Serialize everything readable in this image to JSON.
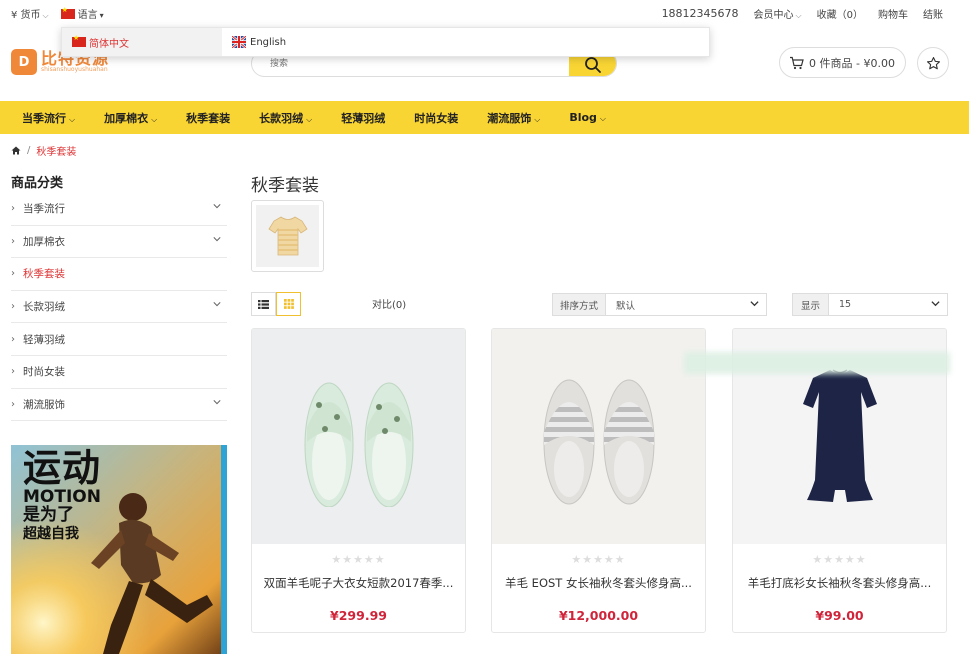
{
  "topbar": {
    "currency_label": "¥ 货币",
    "language_label": "语言",
    "phone": "18812345678",
    "account_label": "会员中心",
    "wishlist_label": "收藏（0）",
    "cart_label": "购物车",
    "checkout_label": "结账"
  },
  "language_dropdown": {
    "options": [
      {
        "label": "简体中文",
        "selected": true
      },
      {
        "label": "English",
        "selected": false
      }
    ]
  },
  "logo": {
    "text_cn": "比特资源",
    "text_en": "shisanshuoyushuahan",
    "mark": "D"
  },
  "search": {
    "placeholder": "搜索"
  },
  "cart": {
    "summary": "0 件商品 - ¥0.00"
  },
  "nav": {
    "items": [
      {
        "label": "当季流行",
        "has_dropdown": true
      },
      {
        "label": "加厚棉衣",
        "has_dropdown": true
      },
      {
        "label": "秋季套装",
        "has_dropdown": false
      },
      {
        "label": "长款羽绒",
        "has_dropdown": true
      },
      {
        "label": "轻薄羽绒",
        "has_dropdown": false
      },
      {
        "label": "时尚女装",
        "has_dropdown": false
      },
      {
        "label": "潮流服饰",
        "has_dropdown": true
      },
      {
        "label": "Blog",
        "has_dropdown": true
      }
    ]
  },
  "breadcrumb": {
    "current": "秋季套装"
  },
  "sidebar": {
    "title": "商品分类",
    "items": [
      {
        "label": "当季流行",
        "expandable": true,
        "active": false
      },
      {
        "label": "加厚棉衣",
        "expandable": true,
        "active": false
      },
      {
        "label": "秋季套装",
        "expandable": false,
        "active": true
      },
      {
        "label": "长款羽绒",
        "expandable": true,
        "active": false
      },
      {
        "label": "轻薄羽绒",
        "expandable": false,
        "active": false
      },
      {
        "label": "时尚女装",
        "expandable": false,
        "active": false
      },
      {
        "label": "潮流服饰",
        "expandable": true,
        "active": false
      }
    ],
    "banner": {
      "line1": "运动",
      "line2": "MOTION",
      "line3": "是为了",
      "line4": "超越自我"
    }
  },
  "main": {
    "title": "秋季套装",
    "compare_label": "对比(0)",
    "sort_label": "排序方式",
    "sort_value": "默认",
    "limit_label": "显示",
    "limit_value": "15"
  },
  "products": [
    {
      "name": "双面羊毛呢子大衣女短款2017春季...",
      "price": "¥299.99",
      "rating": 0,
      "image": "slippers-green"
    },
    {
      "name": "羊毛 EOST 女长袖秋冬套头修身高...",
      "price": "¥12,000.00",
      "rating": 0,
      "image": "slippers-grey-stripe"
    },
    {
      "name": "羊毛打底衫女长袖秋冬套头修身高...",
      "price": "¥99.00",
      "rating": 0,
      "image": "navy-dress"
    }
  ],
  "colors": {
    "accent": "#f9d534",
    "price": "#d0243a",
    "active_link": "#dd3333",
    "logo": "#f0883a"
  }
}
